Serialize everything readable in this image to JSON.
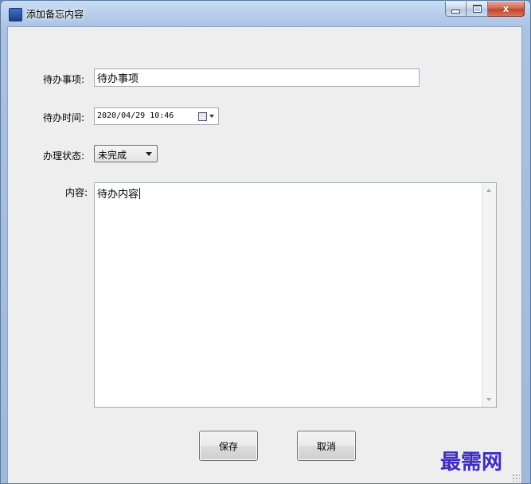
{
  "window": {
    "title": "添加备忘内容",
    "app_icon_glyph": ""
  },
  "caption_buttons": {
    "minimize": "minimize-icon",
    "maximize": "maximize-icon",
    "close": "close-icon",
    "close_glyph": "x"
  },
  "form": {
    "todo_item": {
      "label": "待办事项:",
      "value": "待办事项"
    },
    "todo_time": {
      "label": "待办时间:",
      "value": "2020/04/29 10:46"
    },
    "status": {
      "label": "办理状态:",
      "selected": "未完成"
    },
    "content": {
      "label": "内容:",
      "value": "待办内容"
    }
  },
  "buttons": {
    "save": "保存",
    "cancel": "取消"
  },
  "watermark": "最需网",
  "colors": {
    "watermark": "#3c2cc5",
    "frame": "#a9c2e3",
    "client_bg": "#eeeeee"
  }
}
